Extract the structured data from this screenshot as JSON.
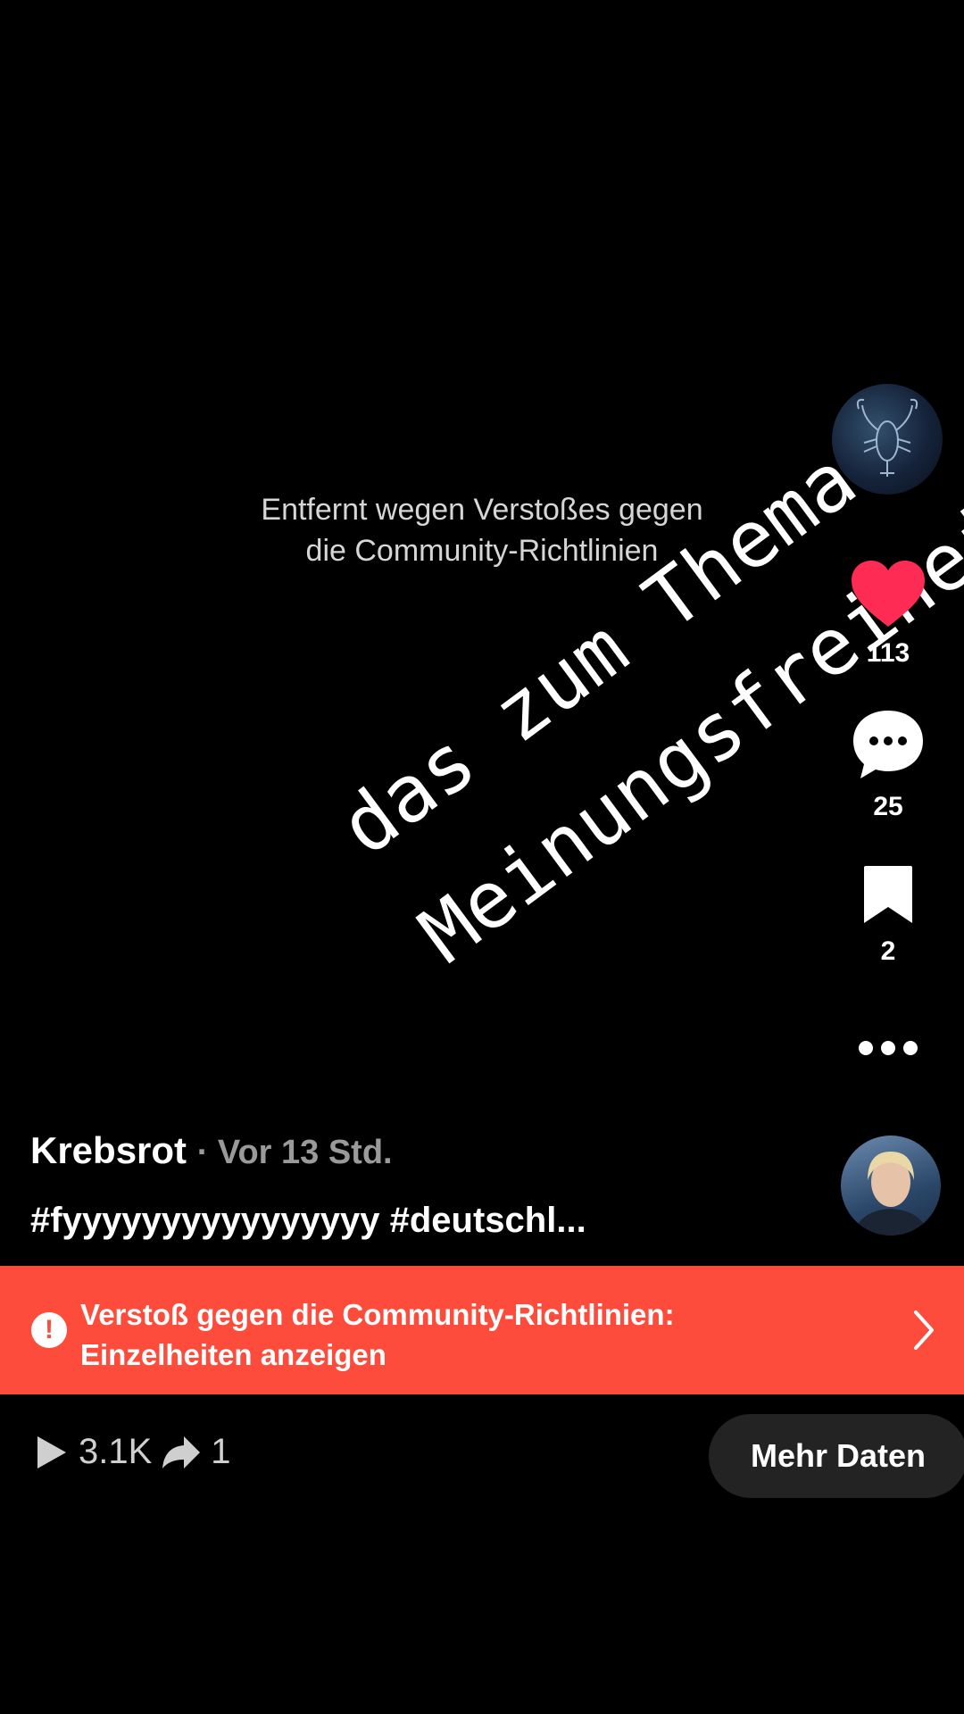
{
  "notice": {
    "line1": "Entfernt wegen Verstoßes gegen",
    "line2": "die Community-Richtlinien"
  },
  "overlay": {
    "line1": "das zum Thema",
    "line2": "Meinungsfreiheit"
  },
  "rail": {
    "likes": "113",
    "comments": "25",
    "saves": "2",
    "like_color": "#fe2c55"
  },
  "post": {
    "author": "Krebsrot",
    "time": "· Vor 13 Std.",
    "caption": "#fyyyyyyyyyyyyyyyy #deutschl..."
  },
  "violation": {
    "line1": "Verstoß gegen die Community-Richtlinien:",
    "line2": "Einzelheiten anzeigen",
    "color": "#fe4c3c"
  },
  "stats": {
    "views": "3.1K",
    "shares": "1"
  },
  "more_button": "Mehr Daten"
}
